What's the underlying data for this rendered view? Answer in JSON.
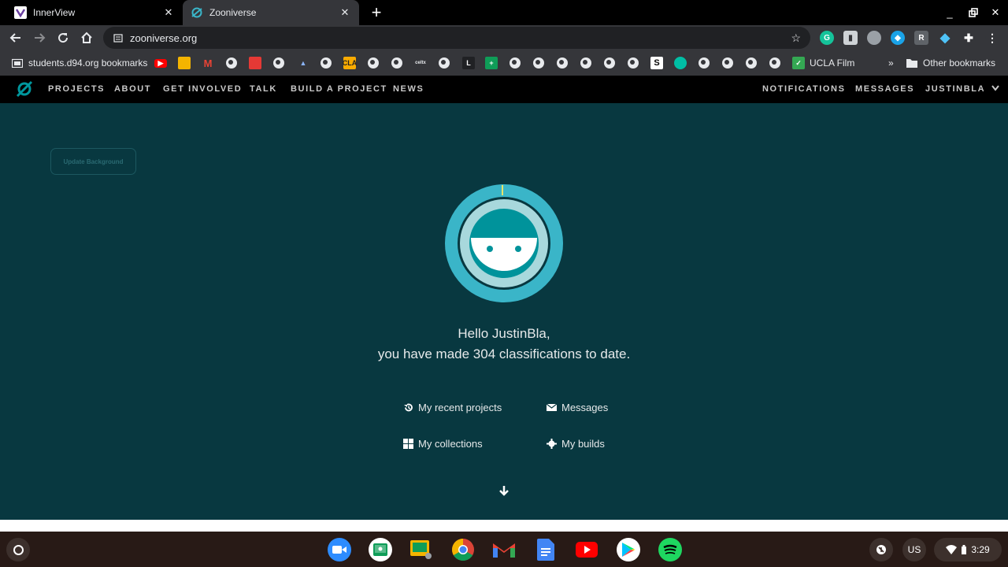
{
  "browser": {
    "tabs": [
      {
        "title": "InnerView",
        "active": false
      },
      {
        "title": "Zooniverse",
        "active": true
      }
    ],
    "address": "zooniverse.org",
    "bookmarks": {
      "folder_label": "students.d94.org bookmarks",
      "ucla_label": "UCLA Film",
      "overflow_label": "»",
      "other_label": "Other bookmarks"
    },
    "ext_letter_r": "R"
  },
  "site": {
    "nav_left": [
      "PROJECTS",
      "ABOUT",
      "GET INVOLVED",
      "TALK",
      "BUILD A PROJECT",
      "NEWS"
    ],
    "nav_right": {
      "notifications": "NOTIFICATIONS",
      "messages": "MESSAGES",
      "user": "JUSTINBLA"
    },
    "update_background": "Update Background",
    "greeting_line1": "Hello JustinBla,",
    "greeting_line2": "you have made 304 classifications to date.",
    "links": {
      "recent_projects": "My recent projects",
      "messages": "Messages",
      "collections": "My collections",
      "builds": "My builds"
    },
    "colors": {
      "hero_bg": "#083840",
      "accent": "#00979d",
      "avatar_ring": "#3ab5c8"
    }
  },
  "shelf": {
    "locale": "US",
    "time": "3:29"
  }
}
